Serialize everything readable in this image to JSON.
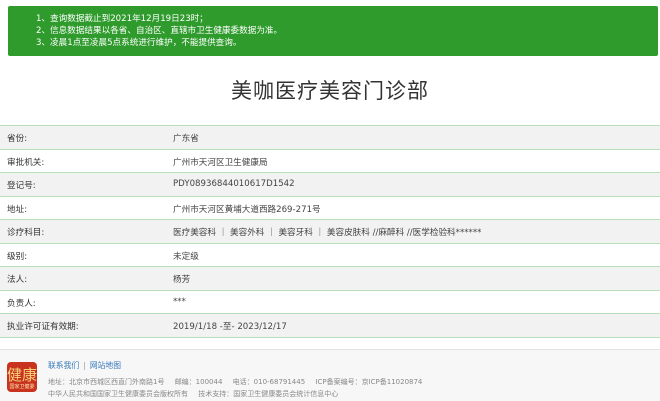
{
  "notice": {
    "lines": [
      "1、查询数据截止到2021年12月19日23时；",
      "2、信息数据结果以各省、自治区、直辖市卫生健康委数据为准。",
      "3、凌晨1点至凌晨5点系统进行维护，不能提供查询。"
    ]
  },
  "title": "美咖医疗美容门诊部",
  "rows": [
    {
      "label": "省份:",
      "value": "广东省"
    },
    {
      "label": "审批机关:",
      "value": "广州市天河区卫生健康局"
    },
    {
      "label": "登记号:",
      "value": "PDY08936844010617D1542"
    },
    {
      "label": "地址:",
      "value": "广州市天河区黄埔大道西路269-271号"
    },
    {
      "label": "诊疗科目:",
      "value": "医疗美容科 ｜ 美容外科 ｜ 美容牙科 ｜ 美容皮肤科 //麻醉科 //医学检验科******"
    },
    {
      "label": "级别:",
      "value": "未定级"
    },
    {
      "label": "法人:",
      "value": "杨芳"
    },
    {
      "label": "负责人:",
      "value": "***"
    },
    {
      "label": "执业许可证有效期:",
      "value": "2019/1/18 -至- 2023/12/17"
    }
  ],
  "footer": {
    "logo_text": "健康",
    "logo_caption": "国家卫健委",
    "links": [
      "联系我们",
      "网站地图"
    ],
    "address": "地址：北京市西城区西直门外南路1号",
    "postcode": "邮编：100044",
    "phone": "电话：010-68791445",
    "icp": "ICP备案编号：京ICP备11020874",
    "copyright": "中华人民共和国国家卫生健康委员会版权所有",
    "support": "技术支持：国家卫生健康委员会统计信息中心"
  }
}
